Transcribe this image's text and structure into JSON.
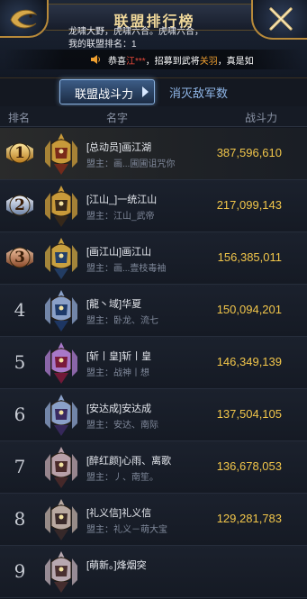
{
  "header": {
    "title": "联盟排行榜",
    "system_message_1": "龙啸大野，虎啸六合。虎啸六合，",
    "system_message_2": "我的联盟排名：1",
    "announcement_prefix": "恭喜",
    "announcement_player": "江***",
    "announcement_middle": "，招募到武将",
    "announcement_general": "关羽",
    "announcement_suffix": "，真是如"
  },
  "tabs": [
    {
      "label": "联盟战斗力",
      "active": true
    },
    {
      "label": "消灭敌军数",
      "active": false
    }
  ],
  "columns": {
    "rank": "排名",
    "name": "名字",
    "power": "战斗力"
  },
  "rows": [
    {
      "rank": "1",
      "name": "[总动员]画江湖",
      "leader": "盟主：画...圃圃诅咒你",
      "power": "387,596,610"
    },
    {
      "rank": "2",
      "name": "[江山_]一统江山",
      "leader": "盟主：江山_武帝",
      "power": "217,099,143"
    },
    {
      "rank": "3",
      "name": "[画江山]画江山",
      "leader": "盟主：画...壹枝毒袖",
      "power": "156,385,011"
    },
    {
      "rank": "4",
      "name": "[龍丶域]华夏",
      "leader": "盟主：卧龙、流七",
      "power": "150,094,201"
    },
    {
      "rank": "5",
      "name": "[斩丨皇]斩丨皇",
      "leader": "盟主：战神丨想",
      "power": "146,349,139"
    },
    {
      "rank": "6",
      "name": "[安达成]安达成",
      "leader": "盟主：安达、南际",
      "power": "137,504,105"
    },
    {
      "rank": "7",
      "name": "[醉红颜]心雨、离歌",
      "leader": "盟主：丿、南笙。",
      "power": "136,678,053"
    },
    {
      "rank": "8",
      "name": "[礼义信]礼义信",
      "leader": "盟主：礼义－萌大宝",
      "power": "129,281,783"
    },
    {
      "rank": "9",
      "name": "[萌新。]烽烟突",
      "leader": "",
      "power": ""
    }
  ],
  "colors": {
    "gold": "#f2c64a",
    "accent_blue": "#8ab2e0",
    "bronze": "#b88a3a"
  }
}
